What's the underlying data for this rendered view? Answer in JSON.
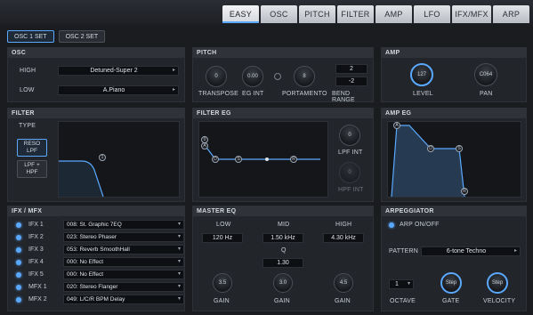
{
  "tabs": [
    "EASY",
    "OSC",
    "PITCH",
    "FILTER",
    "AMP",
    "LFO",
    "IFX/MFX",
    "ARP"
  ],
  "osc_sets": [
    "OSC 1 SET",
    "OSC 2 SET"
  ],
  "osc": {
    "title": "OSC",
    "high_label": "HIGH",
    "high_value": "Detuned-Super 2",
    "low_label": "LOW",
    "low_value": "A.Piano"
  },
  "pitch": {
    "title": "PITCH",
    "transpose": {
      "label": "TRANSPOSE",
      "value": "0"
    },
    "eg_int": {
      "label": "EG INT",
      "value": "0.00"
    },
    "portamento": {
      "label": "PORTAMENTO",
      "value": "8"
    },
    "bend_range": {
      "label": "BEND RANGE",
      "up": "2",
      "down": "-2"
    }
  },
  "amp": {
    "title": "AMP",
    "level": {
      "label": "LEVEL",
      "value": "127"
    },
    "pan": {
      "label": "PAN",
      "value": "C064"
    }
  },
  "filter": {
    "title": "FILTER",
    "type_label": "TYPE",
    "reso_lpf": "RESO\nLPF",
    "lpf_hpf": "LPF +\nHPF",
    "marker": "1"
  },
  "filter_eg": {
    "title": "FILTER EG",
    "lpf_int": {
      "label": "LPF INT",
      "value": "0"
    },
    "hpf_int": {
      "label": "HPF INT",
      "value": "0"
    },
    "points": [
      "0",
      "A",
      "D",
      "S",
      "R"
    ]
  },
  "amp_eg": {
    "title": "AMP EG",
    "points": [
      "A",
      "D",
      "S",
      "R"
    ]
  },
  "ifx": {
    "title": "IFX / MFX",
    "rows": [
      {
        "name": "IFX 1",
        "value": "008: St. Graphic 7EQ"
      },
      {
        "name": "IFX 2",
        "value": "023: Stereo Phaser"
      },
      {
        "name": "IFX 3",
        "value": "053: Reverb SmoothHall"
      },
      {
        "name": "IFX 4",
        "value": "000: No Effect"
      },
      {
        "name": "IFX 5",
        "value": "000: No Effect"
      },
      {
        "name": "MFX 1",
        "value": "020: Stereo Flanger"
      },
      {
        "name": "MFX 2",
        "value": "049: L/C/R BPM Delay"
      }
    ]
  },
  "master_eq": {
    "title": "MASTER EQ",
    "low_label": "LOW",
    "mid_label": "MID",
    "high_label": "HIGH",
    "low_freq": "120 Hz",
    "mid_freq": "1.50 kHz",
    "high_freq": "4.30 kHz",
    "q_label": "Q",
    "q_value": "1.30",
    "gain_label": "GAIN",
    "gains": [
      "3.5",
      "3.0",
      "4.5"
    ]
  },
  "arp": {
    "title": "ARPEGGIATOR",
    "on_off": "ARP ON/OFF",
    "pattern_label": "PATTERN",
    "pattern_value": "6-tone Techno",
    "octave_label": "OCTAVE",
    "octave_value": "1",
    "gate_label": "GATE",
    "gate_value": "Step",
    "velocity_label": "VELOCITY",
    "velocity_value": "Step"
  },
  "colors": {
    "accent": "#5aa9ff",
    "bg": "#1a1c20",
    "panel": "#22252a"
  }
}
